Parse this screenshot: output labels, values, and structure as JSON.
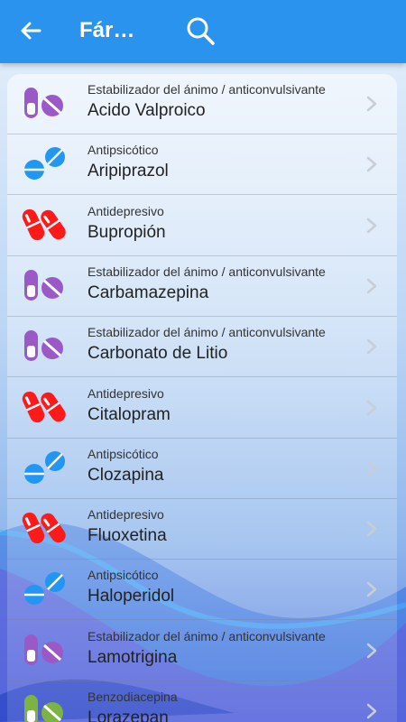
{
  "appbar": {
    "title": "Fárm…",
    "back_icon": "arrow-left-icon",
    "search_icon": "search-icon"
  },
  "colors": {
    "appbar": "#2a93ee",
    "purple": "#9b59c8",
    "blue": "#2196f3",
    "red": "#ff1a1a",
    "green": "#7cb342"
  },
  "drugs": [
    {
      "category": "Estabilizador del ánimo / anticonvulsivante",
      "name": "Acido Valproico",
      "icon": "purple-pills-icon"
    },
    {
      "category": "Antipsicótico",
      "name": "Aripiprazol",
      "icon": "blue-tablets-icon"
    },
    {
      "category": "Antidepresivo",
      "name": "Bupropión",
      "icon": "red-capsules-icon"
    },
    {
      "category": "Estabilizador del ánimo / anticonvulsivante",
      "name": "Carbamazepina",
      "icon": "purple-pills-icon"
    },
    {
      "category": "Estabilizador del ánimo / anticonvulsivante",
      "name": "Carbonato de Litio",
      "icon": "purple-pills-icon"
    },
    {
      "category": "Antidepresivo",
      "name": "Citalopram",
      "icon": "red-capsules-icon"
    },
    {
      "category": "Antipsicótico",
      "name": "Clozapina",
      "icon": "blue-tablets-icon"
    },
    {
      "category": "Antidepresivo",
      "name": "Fluoxetina",
      "icon": "red-capsules-icon"
    },
    {
      "category": "Antipsicótico",
      "name": "Haloperidol",
      "icon": "blue-tablets-icon"
    },
    {
      "category": "Estabilizador del ánimo / anticonvulsivante",
      "name": "Lamotrigina",
      "icon": "purple-pills-icon"
    },
    {
      "category": "Benzodiacepina",
      "name": "Lorazepan",
      "icon": "green-pills-icon"
    }
  ]
}
